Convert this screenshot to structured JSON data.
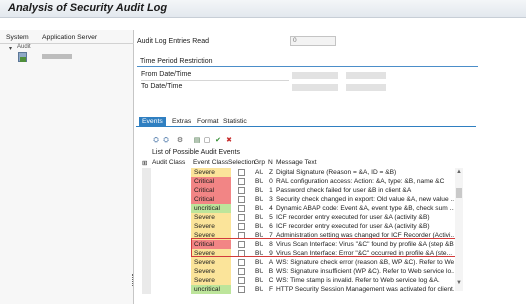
{
  "window": {
    "title": "Analysis of Security Audit Log"
  },
  "tree": {
    "columns": [
      "System",
      "Application Server"
    ],
    "toggle": "▾",
    "node_label": "Audit"
  },
  "form": {
    "entries_label": "Audit Log Entries Read",
    "entries_value": "0",
    "period_title": "Time Period Restriction",
    "from_label": "From Date/Time",
    "to_label": "To Date/Time"
  },
  "tabs": [
    "Events",
    "Extras",
    "Format",
    "Statistic"
  ],
  "active_tab": "Events",
  "toolbar": {
    "icons": [
      "binoculars-icon",
      "binoculars-next-icon",
      "settings-icon",
      "select-all-icon",
      "deselect-all-icon",
      "check-icon",
      "delete-icon"
    ],
    "glyphs": [
      "⛭",
      "⛭",
      "⚙",
      "▤",
      "▢",
      "✔",
      "✖"
    ]
  },
  "list": {
    "title": "List of Possible Audit Events",
    "headers": [
      "Audit Class",
      "Event Class",
      "Selection",
      "Grp",
      "N",
      "Message Text"
    ],
    "rows": [
      {
        "event_class": "Severe",
        "grp": "AU",
        "n": "Z",
        "message": "Digital Signature (Reason = &A, ID = &B)"
      },
      {
        "event_class": "Critical",
        "grp": "BU",
        "n": "0",
        "message": "RAL configuration access: Action: &A, type: &B, name &C"
      },
      {
        "event_class": "Critical",
        "grp": "BU",
        "n": "1",
        "message": "Password check failed for user &B in client &A"
      },
      {
        "event_class": "Critical",
        "grp": "BU",
        "n": "3",
        "message": "Security check changed in export: Old value &A, new value ..."
      },
      {
        "event_class": "uncritical",
        "grp": "BU",
        "n": "4",
        "message": "Dynamic ABAP code: Event &A, event type &B, check sum ..."
      },
      {
        "event_class": "Severe",
        "grp": "BU",
        "n": "5",
        "message": "ICF recorder entry executed for user &A (activity &B)"
      },
      {
        "event_class": "Severe",
        "grp": "BU",
        "n": "6",
        "message": "ICF recorder entry executed for user &A (activity &B)"
      },
      {
        "event_class": "Severe",
        "grp": "BU",
        "n": "7",
        "message": "Administration setting was changed for ICF Recorder (Activi..."
      },
      {
        "event_class": "Critical",
        "grp": "BU",
        "n": "8",
        "message": "Virus Scan Interface: Virus \"&C\" found by profile &A (step &B)"
      },
      {
        "event_class": "Severe",
        "grp": "BU",
        "n": "9",
        "message": "Virus Scan Interface: Error \"&C\" occurred in profile &A (ste..."
      },
      {
        "event_class": "Severe",
        "grp": "BU",
        "n": "A",
        "message": "WS: Signature check error (reason &B, WP &C). Refer to We..."
      },
      {
        "event_class": "Severe",
        "grp": "BU",
        "n": "B",
        "message": "WS: Signature insufficient (WP &C). Refer to Web service lo..."
      },
      {
        "event_class": "Severe",
        "grp": "BU",
        "n": "C",
        "message": "WS: Time stamp is invalid. Refer to Web service log &A."
      },
      {
        "event_class": "uncritical",
        "grp": "BU",
        "n": "F",
        "message": "HTTP Security Session Management was activated for client..."
      }
    ]
  },
  "colors": {
    "Severe": "#fbe49a",
    "Critical": "#f28585",
    "uncritical": "#bde59b",
    "highlight_border": "#d33a3a",
    "tab_active": "#2f7fc1"
  },
  "scrollbar": {
    "up": "▲",
    "down": "▼"
  }
}
